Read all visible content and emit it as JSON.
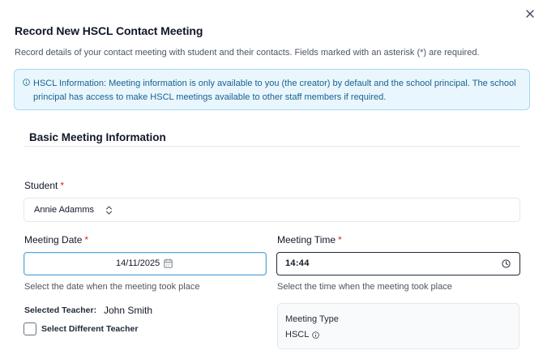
{
  "dialog": {
    "title": "Record New HSCL Contact Meeting",
    "description": "Record details of your contact meeting with student and their contacts. Fields marked with an asterisk (*) are required.",
    "close_icon": "close-icon"
  },
  "info": {
    "icon": "info-icon",
    "text": "HSCL Information: Meeting information is only available to you (the creator) by default and the school principal. The school principal has access to make HSCL meetings available to other staff members if required."
  },
  "section": {
    "title": "Basic Meeting Information"
  },
  "student": {
    "label": "Student",
    "required_mark": "*",
    "value": "Annie Adamms",
    "icon": "chevrons-up-down-icon"
  },
  "meeting_date": {
    "label": "Meeting Date",
    "required_mark": "*",
    "value": "14/11/2025",
    "hint": "Select the date when the meeting took place",
    "icon": "calendar-icon"
  },
  "meeting_time": {
    "label": "Meeting Time",
    "required_mark": "*",
    "value": "14:44",
    "hint": "Select the time when the meeting took place",
    "icon": "clock-icon"
  },
  "teacher": {
    "label": "Selected Teacher:",
    "name": "John Smith",
    "checkbox_label": "Select Different Teacher",
    "checked": false
  },
  "meeting_type": {
    "label": "Meeting Type",
    "value": "HSCL",
    "icon": "info-icon"
  },
  "colors": {
    "info_bg": "#eaf6fd",
    "info_border": "#a3d9f4",
    "info_text": "#17628f",
    "required": "#dc2626",
    "focus_border": "#5aa8d9"
  }
}
